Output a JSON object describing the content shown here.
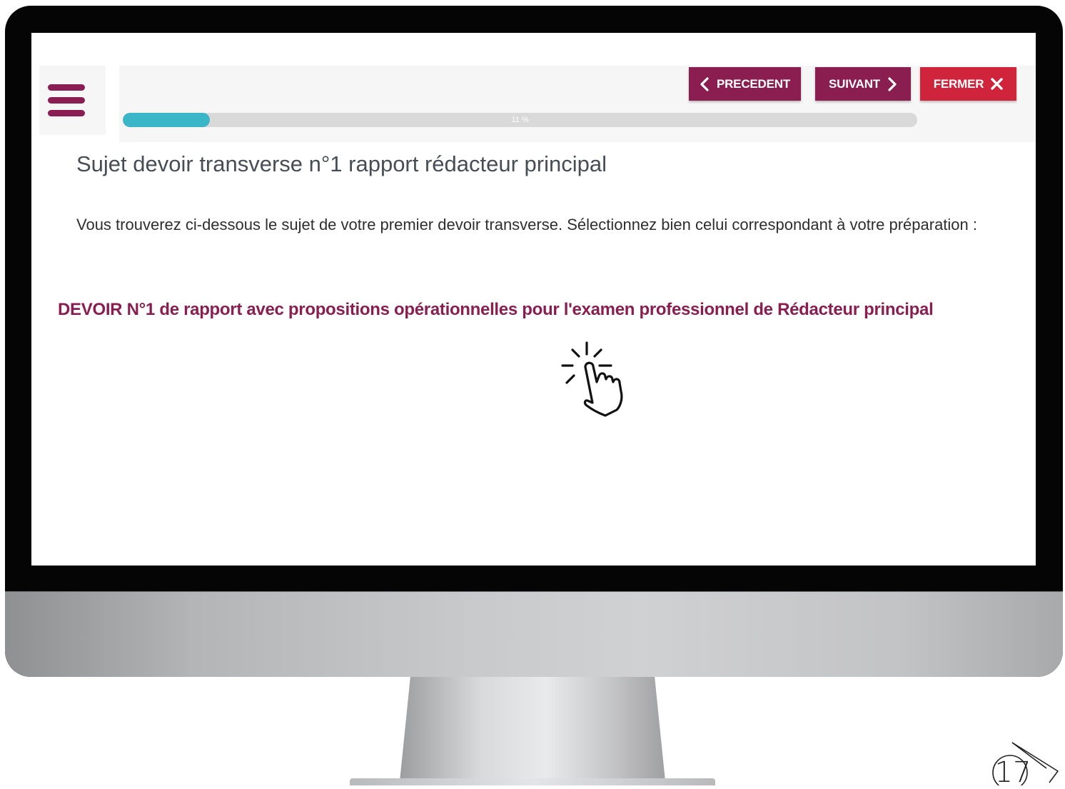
{
  "header": {
    "progress_label": "11 %",
    "progress_fraction": 0.11,
    "prev_label": "PRECEDENT",
    "next_label": "SUIVANT",
    "close_label": "FERMER"
  },
  "content": {
    "title": "Sujet devoir transverse n°1 rapport rédacteur principal",
    "intro": "Vous trouverez ci-dessous le sujet de votre premier devoir transverse. Sélectionnez bien celui correspondant à votre préparation :",
    "devoir_link": "DEVOIR N°1 de rapport avec propositions opérationnelles pour l'examen professionnel de Rédacteur principal"
  },
  "slide_number": "17",
  "icons": {
    "menu": "hamburger-menu-icon",
    "prev": "chevron-left-icon",
    "next": "chevron-right-icon",
    "close": "close-x-icon",
    "cursor": "click-hand-icon",
    "badge": "next-arrow-badge-icon"
  },
  "colors": {
    "brand": "#8b1e50",
    "close": "#d0233c",
    "progress": "#3ab6c8",
    "track": "#d9d9d9"
  }
}
